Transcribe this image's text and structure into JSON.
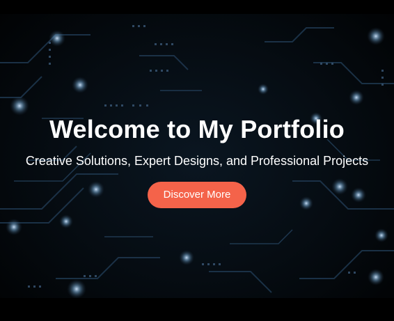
{
  "hero": {
    "title": "Welcome to My Portfolio",
    "subtitle": "Creative Solutions, Expert Designs, and Professional Projects",
    "cta_label": "Discover More",
    "background_icon": "circuit-board-background",
    "colors": {
      "background": "#020305",
      "text": "#ffffff",
      "cta": "#f4634a",
      "circuit_glow": "#5f8fb5"
    }
  }
}
